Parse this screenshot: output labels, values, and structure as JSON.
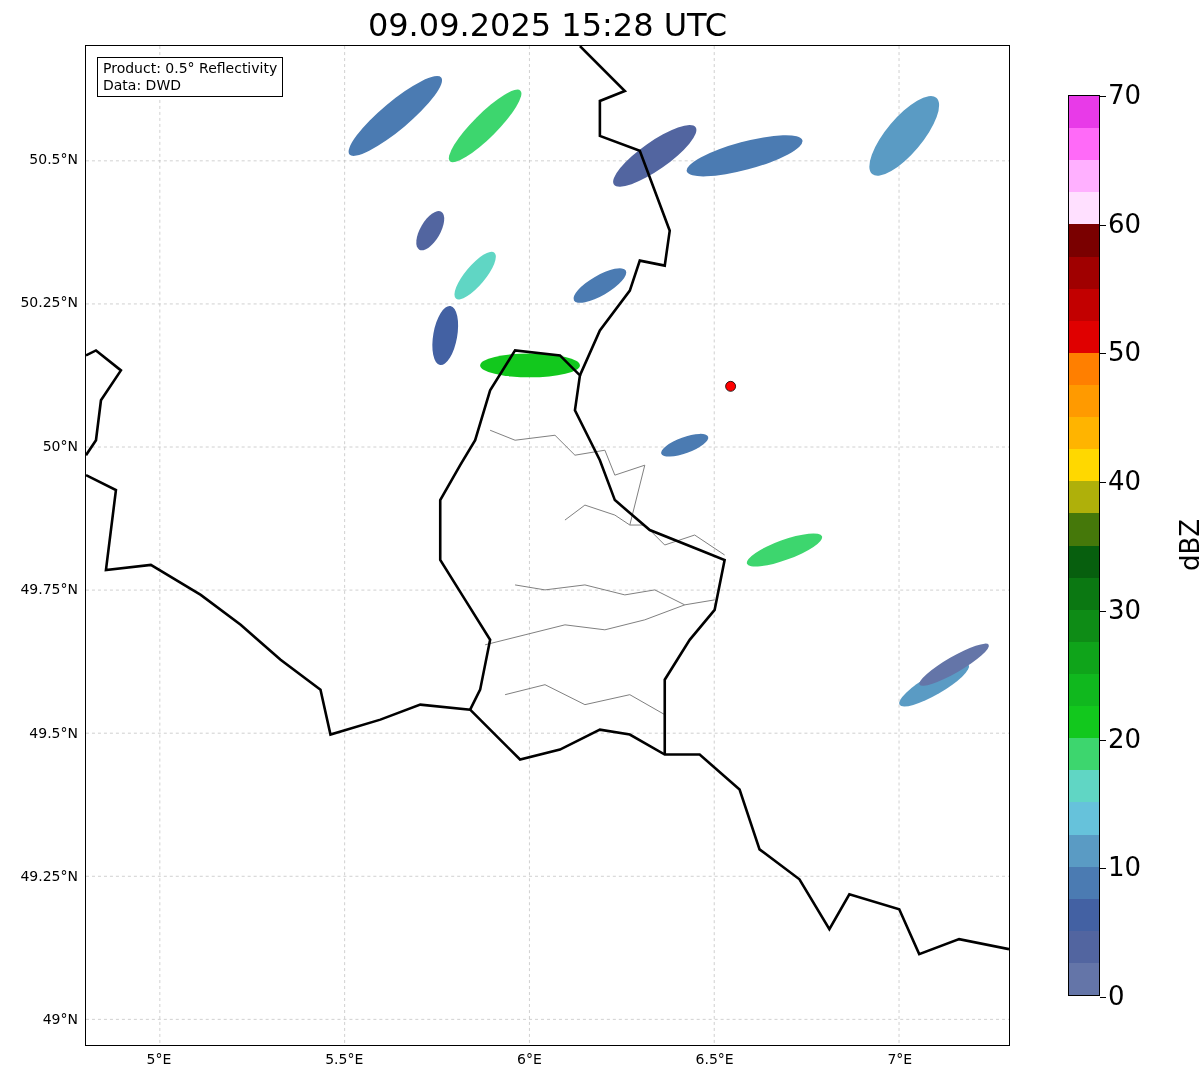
{
  "title": "09.09.2025 15:28 UTC",
  "info_box": {
    "lines": [
      "Product: 0.5° Reflectivity",
      "Data: DWD"
    ]
  },
  "map": {
    "yticks": [
      "50.5°N",
      "50.25°N",
      "50°N",
      "49.75°N",
      "49.5°N",
      "49.25°N",
      "49°N"
    ],
    "xticks": [
      "5°E",
      "5.5°E",
      "6°E",
      "6.5°E",
      "7°E"
    ]
  },
  "colorbar": {
    "label": "dBZ",
    "ticks": [
      "70",
      "60",
      "50",
      "40",
      "30",
      "20",
      "10",
      "0"
    ],
    "bands": [
      {
        "color": "#e83ae8"
      },
      {
        "color": "#ff6af8"
      },
      {
        "color": "#ffb0ff"
      },
      {
        "color": "#ffe0ff"
      },
      {
        "color": "#7a0000"
      },
      {
        "color": "#a00000"
      },
      {
        "color": "#c20000"
      },
      {
        "color": "#e00000"
      },
      {
        "color": "#ff7f00"
      },
      {
        "color": "#ff9a00"
      },
      {
        "color": "#ffb400"
      },
      {
        "color": "#ffd800"
      },
      {
        "color": "#afb00a"
      },
      {
        "color": "#45780a"
      },
      {
        "color": "#075f0e"
      },
      {
        "color": "#0b7812"
      },
      {
        "color": "#0e8c16"
      },
      {
        "color": "#0fa41a"
      },
      {
        "color": "#10b81e"
      },
      {
        "color": "#12c81d"
      },
      {
        "color": "#3dd66e"
      },
      {
        "color": "#60d6c4"
      },
      {
        "color": "#66c2db"
      },
      {
        "color": "#5a9bc4"
      },
      {
        "color": "#4b7bb2"
      },
      {
        "color": "#4361a3"
      },
      {
        "color": "#5265a0"
      },
      {
        "color": "#6475a8"
      }
    ]
  }
}
